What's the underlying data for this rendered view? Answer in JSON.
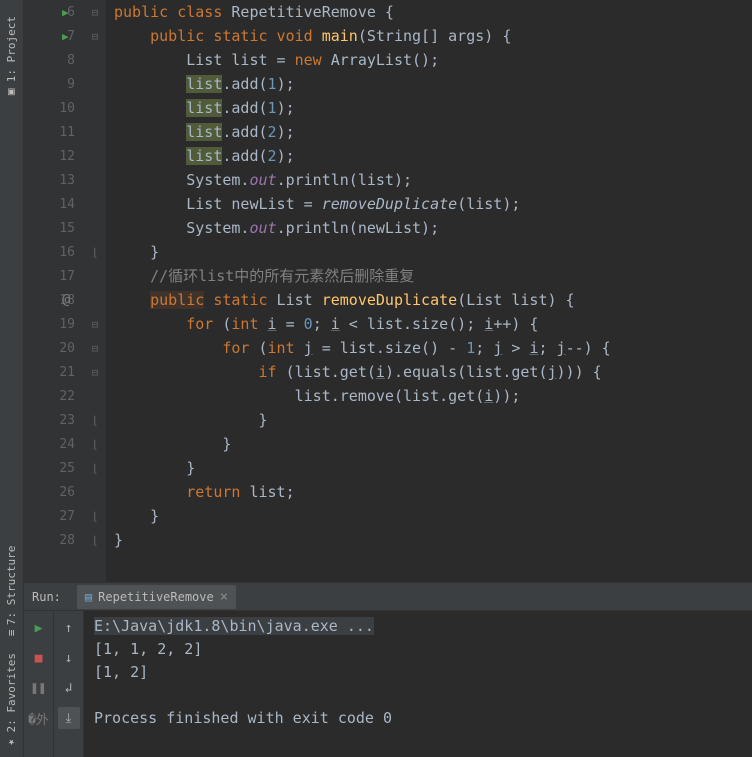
{
  "sidebar": {
    "tabs": [
      "1: Project",
      "7: Structure",
      "2: Favorites"
    ]
  },
  "gutter": {
    "start": 6,
    "end": 28,
    "run_lines": [
      6,
      7
    ],
    "at_lines": [
      18
    ],
    "fold_open": [
      6,
      7,
      19,
      20,
      21
    ],
    "fold_close": [
      16,
      23,
      24,
      25,
      27,
      28
    ]
  },
  "code": {
    "lines": [
      {
        "n": 6,
        "html": "<span class='kw'>public class</span> <span class='cls'>RepetitiveRemove</span> {"
      },
      {
        "n": 7,
        "html": "    <span class='kw'>public static void</span> <span class='method-decl'>main</span>(String[] args) {"
      },
      {
        "n": 8,
        "html": "        List list = <span class='kw'>new</span> ArrayList();"
      },
      {
        "n": 9,
        "html": "        <span class='highlight-list'>list</span>.add(<span class='num'>1</span>);"
      },
      {
        "n": 10,
        "html": "        <span class='highlight-list'>list</span>.add(<span class='num'>1</span>);"
      },
      {
        "n": 11,
        "html": "        <span class='highlight-list'>list</span>.add(<span class='num'>2</span>);"
      },
      {
        "n": 12,
        "html": "        <span class='highlight-list'>list</span>.add(<span class='num'>2</span>);"
      },
      {
        "n": 13,
        "html": "        System.<span class='field-static'>out</span>.println(list);"
      },
      {
        "n": 14,
        "html": "        List newList = <span class='italic-call'>removeDuplicate</span>(list);"
      },
      {
        "n": 15,
        "html": "        System.<span class='field-static'>out</span>.println(newList);"
      },
      {
        "n": 16,
        "html": "    }"
      },
      {
        "n": 17,
        "html": "    <span class='comment'>//循环list中的所有元素然后删除重复</span>"
      },
      {
        "n": 18,
        "html": "    <span class='highlight-pub'><span class='kw'>public</span></span> <span class='kw'>static</span> List <span class='method-decl'>removeDuplicate</span>(List list) {"
      },
      {
        "n": 19,
        "html": "        <span class='kw'>for</span> (<span class='kw'>int</span> <span class='underline'>i</span> = <span class='num'>0</span>; <span class='underline'>i</span> &lt; list.size(); <span class='underline'>i</span>++) {"
      },
      {
        "n": 20,
        "html": "            <span class='kw'>for</span> (<span class='kw'>int</span> <span class='underline'>j</span> = list.size() - <span class='num'>1</span>; <span class='underline'>j</span> &gt; <span class='underline'>i</span>; <span class='underline'>j</span>--) {"
      },
      {
        "n": 21,
        "html": "                <span class='kw'>if</span> (list.get(<span class='underline'>i</span>).equals(list.get(<span class='underline'>j</span>))) {"
      },
      {
        "n": 22,
        "html": "                    list.remove(list.get(<span class='underline'>i</span>));"
      },
      {
        "n": 23,
        "html": "                }"
      },
      {
        "n": 24,
        "html": "            }"
      },
      {
        "n": 25,
        "html": "        }"
      },
      {
        "n": 26,
        "html": "        <span class='kw'>return</span> list;"
      },
      {
        "n": 27,
        "html": "    }"
      },
      {
        "n": 28,
        "html": "}"
      }
    ]
  },
  "run": {
    "label": "Run:",
    "tab_name": "RepetitiveRemove",
    "console": [
      {
        "text": "E:\\Java\\jdk1.8\\bin\\java.exe ...",
        "hl": true
      },
      {
        "text": "[1, 1, 2, 2]",
        "hl": false
      },
      {
        "text": "[1, 2]",
        "hl": false
      },
      {
        "text": "",
        "hl": false
      },
      {
        "text": "Process finished with exit code 0",
        "hl": false
      }
    ]
  }
}
